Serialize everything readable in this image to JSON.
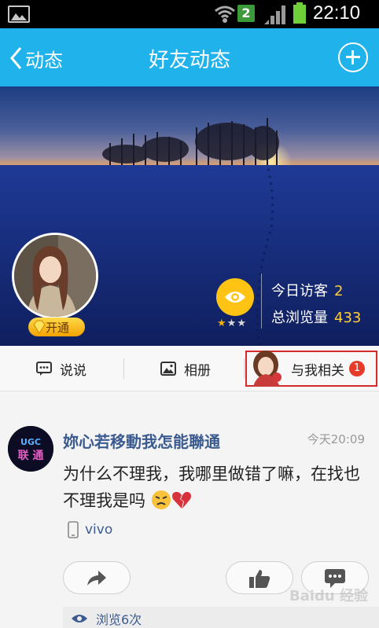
{
  "status_bar": {
    "sim_badge": "2",
    "time": "22:10"
  },
  "header": {
    "back_label": "动态",
    "title": "好友动态"
  },
  "profile": {
    "vip_label": "开通",
    "stats": {
      "today_label": "今日访客",
      "today_value": "2",
      "total_label": "总浏览量",
      "total_value": "433"
    },
    "star_rating": 1
  },
  "tabs": {
    "say": "说说",
    "album": "相册",
    "about_me": "与我相关",
    "about_me_badge": "1"
  },
  "feed": {
    "author": "妳心若移動我怎能聯通",
    "time": "今天20:09",
    "text": "为什么不理我，我哪里做错了嘛，在找也不理我是吗",
    "device": "vivo",
    "views": "浏览6次",
    "avatar_text": "联 通"
  },
  "watermark": "Baidu 经验",
  "colors": {
    "header_bg": "#1fb2eb",
    "accent_blue": "#3b5b90",
    "badge_red": "#e63a2a",
    "highlight_border": "#d42a2a"
  }
}
